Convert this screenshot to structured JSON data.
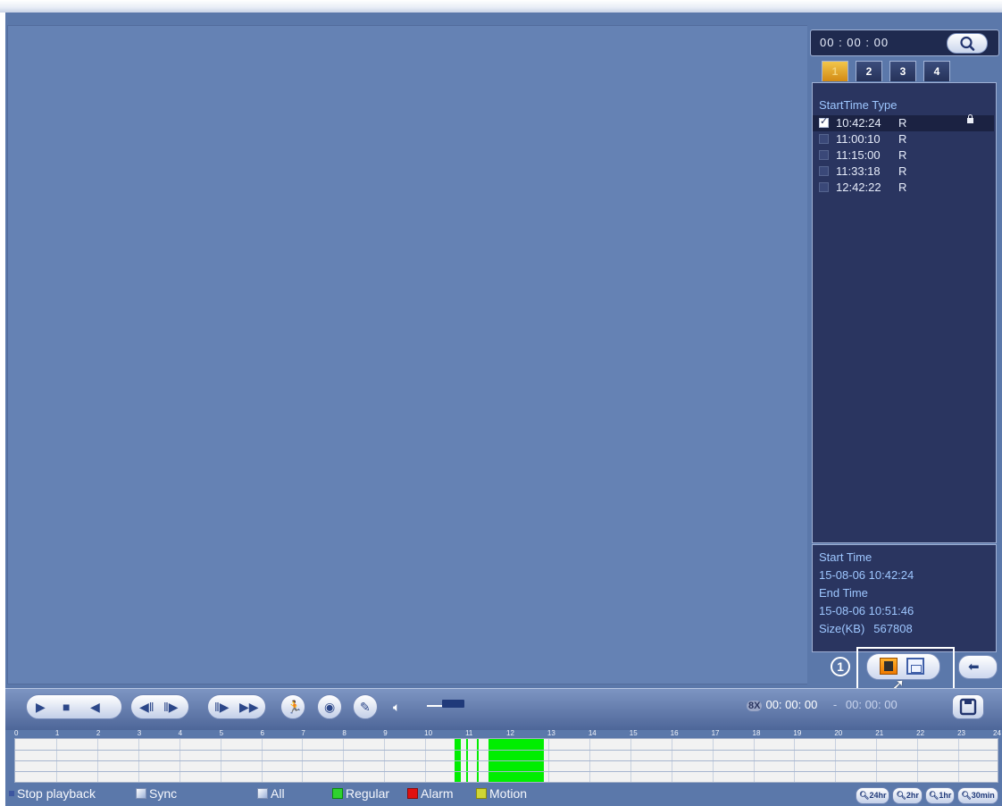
{
  "search": {
    "time": "00 : 00 : 00"
  },
  "tabs": [
    "1",
    "2",
    "3",
    "4"
  ],
  "file_list": {
    "header": "StartTime Type",
    "rows": [
      {
        "time": "10:42:24",
        "type": "R",
        "checked": true,
        "locked": true,
        "selected": true
      },
      {
        "time": "11:00:10",
        "type": "R",
        "checked": false,
        "locked": false,
        "selected": false
      },
      {
        "time": "11:15:00",
        "type": "R",
        "checked": false,
        "locked": false,
        "selected": false
      },
      {
        "time": "11:33:18",
        "type": "R",
        "checked": false,
        "locked": false,
        "selected": false
      },
      {
        "time": "12:42:22",
        "type": "R",
        "checked": false,
        "locked": false,
        "selected": false
      }
    ]
  },
  "file_info": {
    "start_label": "Start Time",
    "start_value": "15-08-06  10:42:24",
    "end_label": "End Time",
    "end_value": "15-08-06  10:51:46",
    "size_label": "Size(KB)",
    "size_value": "567808"
  },
  "callout_number": "1",
  "clip": {
    "start": "00: 00: 00",
    "separator": "-",
    "end": "00: 00: 00",
    "badge": "8X"
  },
  "timeline": {
    "hour_labels": [
      "0",
      "1",
      "2",
      "3",
      "4",
      "5",
      "6",
      "7",
      "8",
      "9",
      "10",
      "11",
      "12",
      "13",
      "14",
      "15",
      "16",
      "17",
      "18",
      "19",
      "20",
      "21",
      "22",
      "23",
      "24"
    ],
    "recording_color": "#00ee00"
  },
  "legend": {
    "stop": "Stop playback",
    "sync": "Sync",
    "all": "All",
    "regular": "Regular",
    "alarm": "Alarm",
    "motion": "Motion"
  },
  "zoom": [
    "24hr",
    "2hr",
    "1hr",
    "30min"
  ],
  "icons": [
    "search-icon",
    "play-icon",
    "stop-icon",
    "reverse-icon",
    "slow-icon",
    "frame-forward-icon",
    "fast-icon",
    "smart-search-icon",
    "snapshot-icon",
    "mark-icon",
    "volume-icon",
    "clip-icon",
    "save-file-icon",
    "back-icon"
  ]
}
